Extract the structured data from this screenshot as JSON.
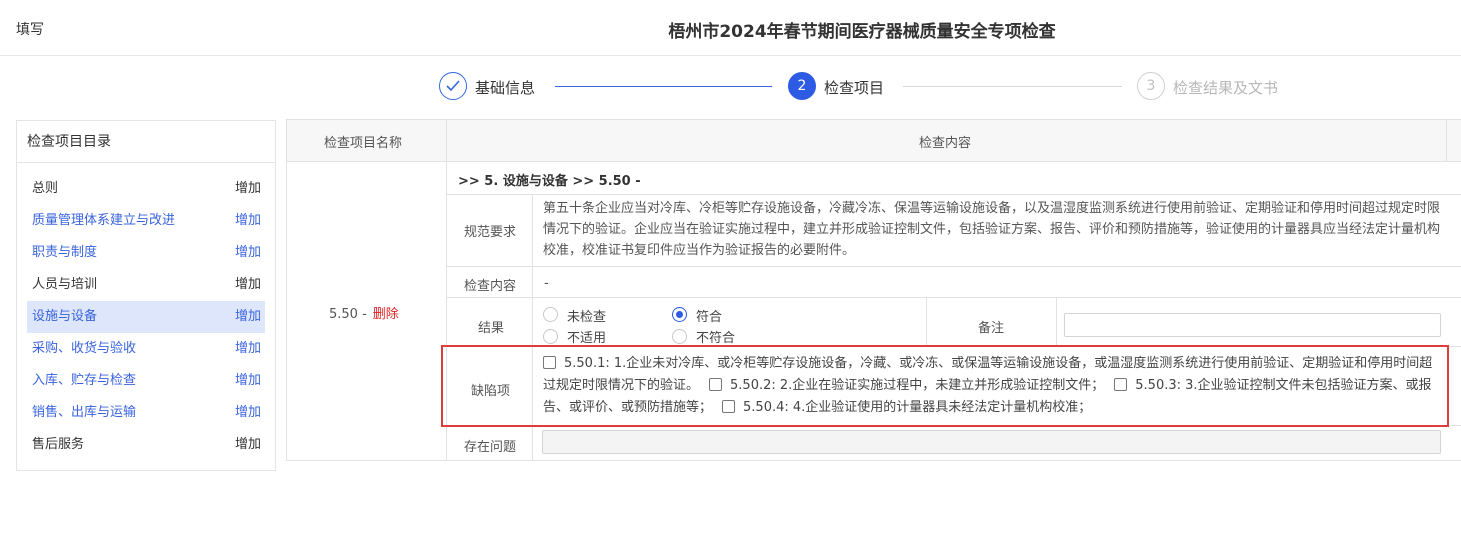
{
  "header": {
    "fill_label": "填写",
    "title": "梧州市2024年春节期间医疗器械质量安全专项检查"
  },
  "steps": [
    {
      "label": "基础信息",
      "state": "done"
    },
    {
      "label": "检查项目",
      "number": "2",
      "state": "active"
    },
    {
      "label": "检查结果及文书",
      "number": "3",
      "state": "todo"
    }
  ],
  "sidebar": {
    "title": "检查项目目录",
    "items": [
      {
        "label": "总则",
        "add": "增加"
      },
      {
        "label": "质量管理体系建立与改进",
        "add": "增加"
      },
      {
        "label": "职责与制度",
        "add": "增加"
      },
      {
        "label": "人员与培训",
        "add": "增加"
      },
      {
        "label": "设施与设备",
        "add": "增加"
      },
      {
        "label": "采购、收货与验收",
        "add": "增加"
      },
      {
        "label": "入库、贮存与检查",
        "add": "增加"
      },
      {
        "label": "销售、出库与运输",
        "add": "增加"
      },
      {
        "label": "售后服务",
        "add": "增加"
      }
    ]
  },
  "table": {
    "col_name_header": "检查项目名称",
    "col_content_header": "检查内容",
    "item_code": "5.50 -",
    "delete_label": "删除",
    "section_path": ">> 5. 设施与设备 >> 5.50 -",
    "rows": {
      "requirement_label": "规范要求",
      "requirement_text": "第五十条企业应当对冷库、冷柜等贮存设施设备，冷藏冷冻、保温等运输设施设备，以及温湿度监测系统进行使用前验证、定期验证和停用时间超过规定时限情况下的验证。企业应当在验证实施过程中，建立并形成验证控制文件，包括验证方案、报告、评价和预防措施等，验证使用的计量器具应当经法定计量机构校准，校准证书复印件应当作为验证报告的必要附件。",
      "content_label": "检查内容",
      "content_value": "-",
      "result_label": "结果",
      "result_options": [
        "未检查",
        "符合",
        "不适用",
        "不符合"
      ],
      "result_selected": "符合",
      "note_label": "备注",
      "note_value": "",
      "defect_label": "缺陷项",
      "defects": [
        "5.50.1: 1.企业未对冷库、或冷柜等贮存设施设备，冷藏、或冷冻、或保温等运输设施设备，或温湿度监测系统进行使用前验证、定期验证和停用时间超过规定时限情况下的验证。",
        "5.50.2: 2.企业在验证实施过程中，未建立并形成验证控制文件；",
        "5.50.3: 3.企业验证控制文件未包括验证方案、或报告、或评价、或预防措施等；",
        "5.50.4: 4.企业验证使用的计量器具未经法定计量机构校准；"
      ],
      "issue_label": "存在问题",
      "issue_value": ""
    }
  },
  "colors": {
    "accent": "#2d5be3",
    "link": "#3a64de",
    "danger": "#e02020",
    "highlight_frame": "#e03c3c"
  }
}
